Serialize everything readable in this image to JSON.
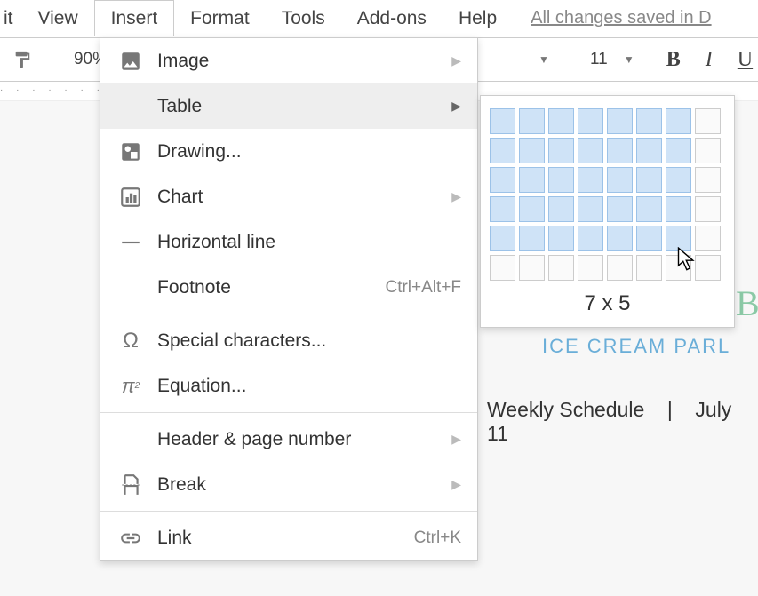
{
  "menubar": {
    "partial_left": "it",
    "view": "View",
    "insert": "Insert",
    "format": "Format",
    "tools": "Tools",
    "addons": "Add-ons",
    "help": "Help",
    "changes_saved": "All changes saved in D"
  },
  "toolbar": {
    "zoom": "90%",
    "font_size": "11"
  },
  "insert_menu": {
    "image": "Image",
    "table": "Table",
    "drawing": "Drawing...",
    "chart": "Chart",
    "horizontal_line": "Horizontal line",
    "footnote": "Footnote",
    "footnote_shortcut": "Ctrl+Alt+F",
    "special_chars": "Special characters...",
    "equation": "Equation...",
    "header_page": "Header & page number",
    "break": "Break",
    "link": "Link",
    "link_shortcut": "Ctrl+K"
  },
  "table_submenu": {
    "cols": 8,
    "rows": 6,
    "selected_cols": 7,
    "selected_rows": 5,
    "size_label": "7 x 5"
  },
  "document": {
    "title_partial": "B",
    "subtitle": "ICE CREAM PARL",
    "schedule_label": "Weekly Schedule",
    "schedule_sep": "|",
    "schedule_date": "July 11"
  }
}
